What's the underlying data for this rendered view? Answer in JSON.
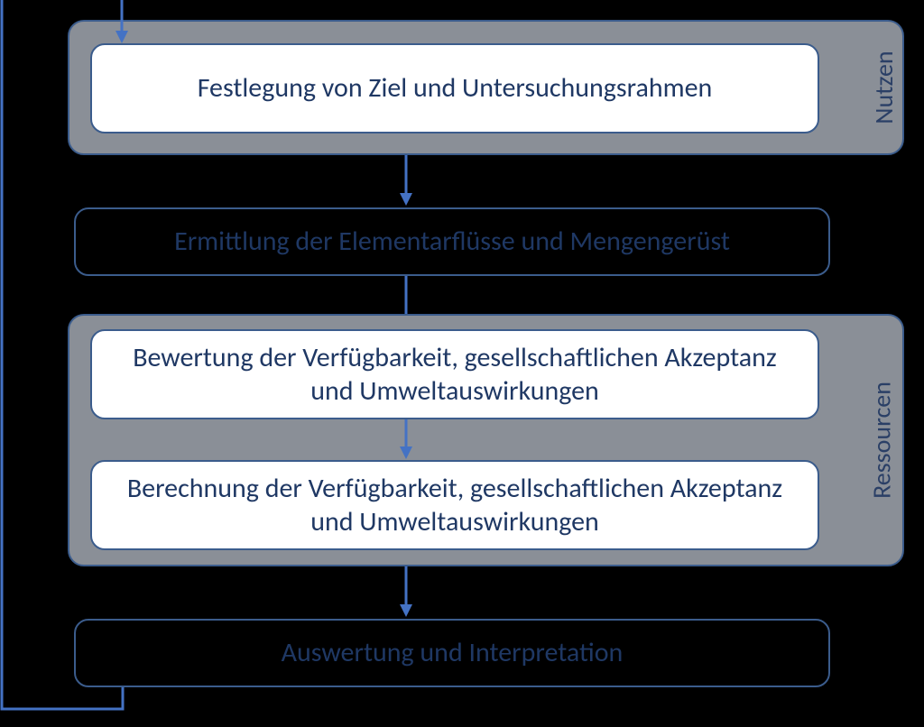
{
  "groups": {
    "nutzen": {
      "label": "Nutzen"
    },
    "ressourcen": {
      "label": "Ressourcen"
    }
  },
  "boxes": {
    "b1": "Festlegung von Ziel und Untersuchungsrahmen",
    "b2": "Ermittlung der Elementarflüsse und Mengengerüst",
    "b3": "Bewertung der Verfügbarkeit, gesellschaftlichen Akzeptanz und Umweltauswirkungen",
    "b4": "Berechnung der Verfügbarkeit, gesellschaftlichen Akzeptanz und Umweltauswirkungen",
    "b5": "Auswertung und Interpretation"
  }
}
